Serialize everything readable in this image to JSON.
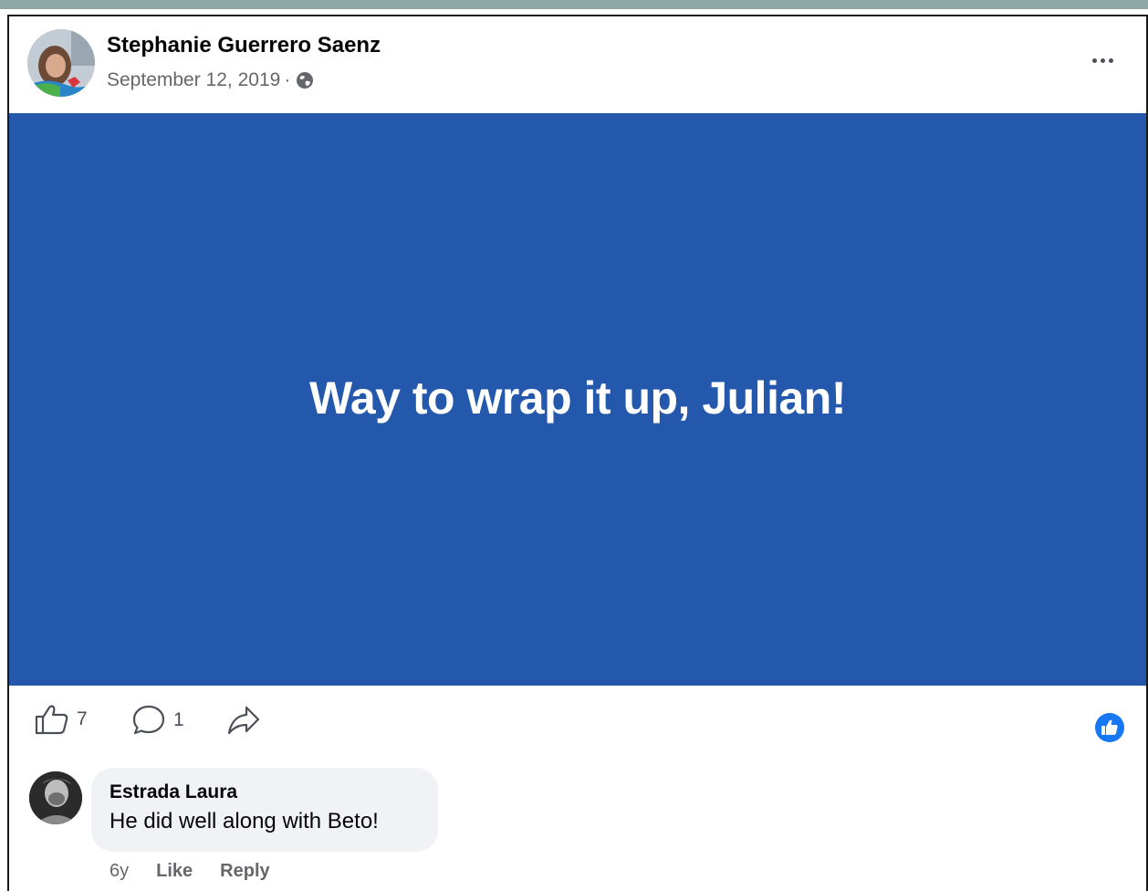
{
  "post": {
    "author": "Stephanie Guerrero Saenz",
    "date": "September 12, 2019",
    "separator": "·",
    "text": "Way to wrap it up, Julian!",
    "background_color": "#2358ac",
    "privacy_icon": "globe-icon",
    "menu_icon": "more-options-icon"
  },
  "actions": {
    "like_count": "7",
    "comment_count": "1",
    "like_icon": "thumbs-up-icon",
    "comment_icon": "comment-bubble-icon",
    "share_icon": "share-arrow-icon",
    "reaction_icon": "like-reaction-icon",
    "reaction_color": "#1877f2"
  },
  "comments": [
    {
      "author": "Estrada Laura",
      "text": "He did well along with Beto!",
      "time": "6y",
      "like_label": "Like",
      "reply_label": "Reply"
    }
  ]
}
